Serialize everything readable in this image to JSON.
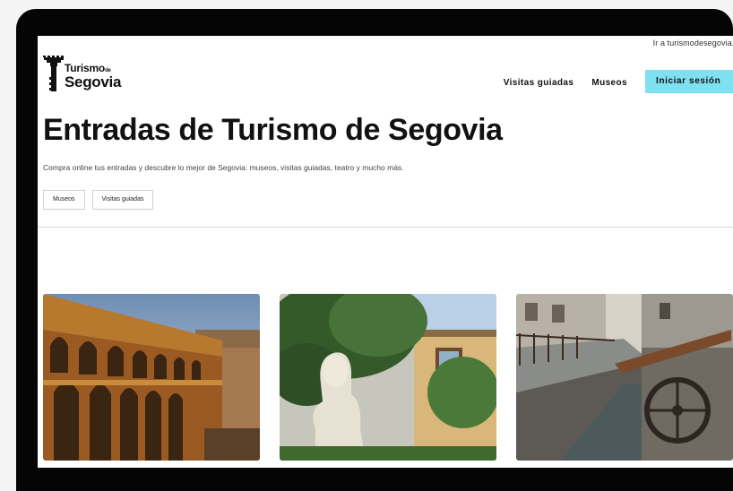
{
  "header": {
    "top_link": "Ir a turismodesegovia.c",
    "logo_line1": "Turismo",
    "logo_small": "de",
    "logo_line2": "Segovia",
    "nav": [
      "Visitas guiadas",
      "Museos"
    ],
    "login_label": "Iniciar sesión"
  },
  "main": {
    "title": "Entradas de Turismo de Segovia",
    "subtitle": "Compra online tus entradas y descubre lo mejor de Segovia: museos, visitas guiadas, teatro y mucho más.",
    "filters": [
      "Museos",
      "Visitas guiadas"
    ]
  },
  "cards": [
    {
      "image": "aqueduct-photo"
    },
    {
      "image": "bust-statue-photo"
    },
    {
      "image": "watermill-photo"
    }
  ],
  "colors": {
    "accent": "#7ee0f0",
    "device_frame": "#050505",
    "text": "#111111"
  }
}
